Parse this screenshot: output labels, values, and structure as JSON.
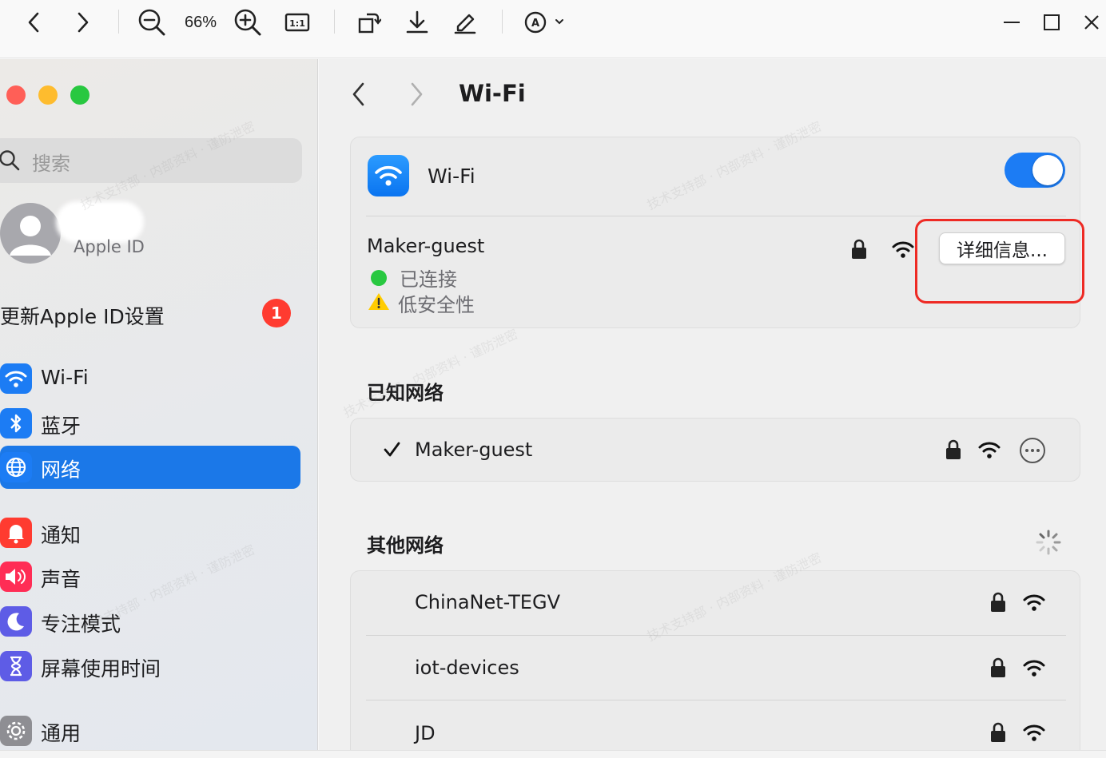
{
  "toolbar": {
    "zoom_level": "66%",
    "icons": [
      "back-icon",
      "forward-icon",
      "zoom-out-icon",
      "zoom-in-icon",
      "actual-size-icon",
      "rotate-icon",
      "download-icon",
      "edit-icon",
      "markup-icon",
      "minimize-icon",
      "maximize-icon",
      "close-icon"
    ]
  },
  "sidebar": {
    "search_placeholder": "搜索",
    "account_label": "Apple ID",
    "update_label": "更新Apple ID设置",
    "update_badge": "1",
    "items": [
      {
        "label": "Wi-Fi",
        "icon": "wifi-icon",
        "color": "#1c7cf4"
      },
      {
        "label": "蓝牙",
        "icon": "bluetooth-icon",
        "color": "#1c7cf4"
      },
      {
        "label": "网络",
        "icon": "globe-icon",
        "color": "#1c7cf4",
        "selected": true
      },
      {
        "label": "通知",
        "icon": "bell-icon",
        "color": "#ff3b30"
      },
      {
        "label": "声音",
        "icon": "speaker-icon",
        "color": "#ff2d55"
      },
      {
        "label": "专注模式",
        "icon": "moon-icon",
        "color": "#5e5ce6"
      },
      {
        "label": "屏幕使用时间",
        "icon": "hourglass-icon",
        "color": "#5e5ce6"
      },
      {
        "label": "通用",
        "icon": "gear-icon",
        "color": "#8e8e93"
      }
    ]
  },
  "main": {
    "title": "Wi-Fi",
    "wifi_card": {
      "label": "Wi-Fi",
      "toggle_on": true,
      "current_network": "Maker-guest",
      "status_connected": "已连接",
      "status_security": "低安全性",
      "details_button": "详细信息..."
    },
    "known_networks": {
      "title": "已知网络",
      "items": [
        {
          "name": "Maker-guest",
          "checked": true
        }
      ]
    },
    "other_networks": {
      "title": "其他网络",
      "items": [
        {
          "name": "ChinaNet-TEGV"
        },
        {
          "name": "iot-devices"
        },
        {
          "name": "JD"
        }
      ]
    }
  },
  "colors": {
    "accent": "#1b78e8",
    "highlight": "#ee2a24",
    "badge": "#ff3b30"
  }
}
